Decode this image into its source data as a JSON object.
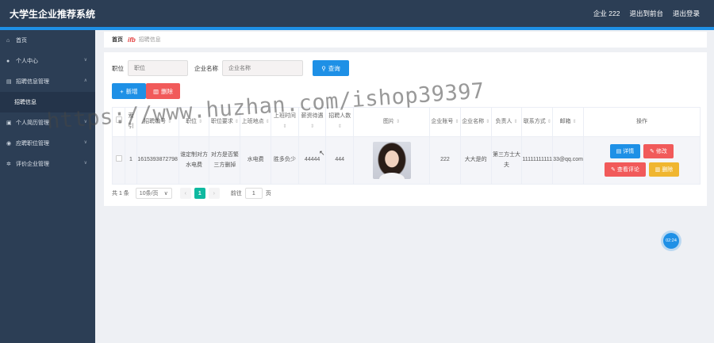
{
  "header": {
    "title": "大学生企业推荐系统",
    "user_label": "企业 222",
    "back_label": "退出到前台",
    "logout_label": "退出登录"
  },
  "sidebar": {
    "items": [
      {
        "label": "首页",
        "icon": "home-icon"
      },
      {
        "label": "个人中心",
        "icon": "user-icon"
      },
      {
        "label": "招聘信息管理",
        "icon": "list-icon"
      },
      {
        "label": "招聘信息",
        "sub": true
      },
      {
        "label": "个人简历管理",
        "icon": "document-icon"
      },
      {
        "label": "应聘职位管理",
        "icon": "location-icon"
      },
      {
        "label": "评价企业管理",
        "icon": "gear-icon"
      }
    ]
  },
  "breadcrumb": {
    "home": "首页",
    "current": "招聘信息"
  },
  "search": {
    "position_label": "职位",
    "position_placeholder": "职位",
    "company_label": "企业名称",
    "company_placeholder": "企业名称",
    "button_label": "查询"
  },
  "actions": {
    "add_label": "新增",
    "delete_label": "删除"
  },
  "table": {
    "headers": [
      "索引",
      "招聘编号",
      "职位",
      "职位要求",
      "上班地点",
      "上班时间",
      "薪资待遇",
      "招聘人数",
      "图片",
      "企业账号",
      "企业名称",
      "负责人",
      "联系方式",
      "邮箱",
      "操作"
    ],
    "rows": [
      {
        "index": "1",
        "code": "1615393872798",
        "position": "谁定制对方水电费",
        "requirement": "对方是否繁三方删掉",
        "location": "水电费",
        "time": "胜多负少",
        "salary": "44444",
        "count": "444",
        "account": "222",
        "company": "大大是的",
        "manager": "第三方士大夫",
        "phone": "11111111111",
        "email": "33@qq.com"
      }
    ],
    "row_actions": {
      "detail": "详情",
      "edit": "修改",
      "review": "查看评论",
      "delete": "删除"
    }
  },
  "pagination": {
    "total": "共 1 条",
    "page_size": "10条/页",
    "current_page": "1",
    "goto_label": "前往",
    "goto_value": "1",
    "page_unit": "页"
  },
  "float_button": "02:24",
  "watermark": "https://www.huzhan.com/ishop39397",
  "colors": {
    "topbar": "#2c3e55",
    "accent": "#1e90e6",
    "danger": "#f15a5a",
    "warning": "#f0b630",
    "page_active": "#0fb9a0"
  }
}
